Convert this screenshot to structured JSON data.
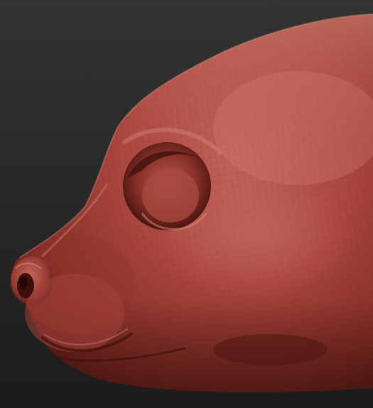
{
  "scene": {
    "subject": "sculpt-head-side-view",
    "background_color": "#2b2b2b",
    "material_base_color": "#a8453c",
    "material_shadow_color": "#5a1d18",
    "material_highlight_color": "#d98a7c",
    "wireframe_color": "#7a2c26"
  }
}
